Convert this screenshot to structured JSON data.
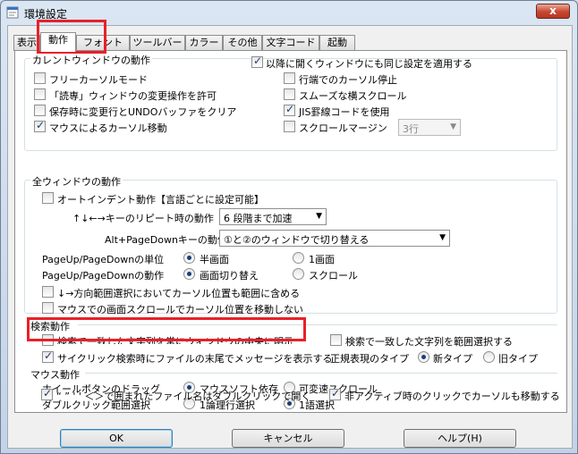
{
  "window": {
    "title": "環境設定",
    "close": "x"
  },
  "tabs": [
    "表示",
    "動作",
    "フォント",
    "ツールバー",
    "カラー",
    "その他",
    "文字コード",
    "起動"
  ],
  "current_window": {
    "title": "カレントウィンドウの動作",
    "apply_future": "以降に開くウィンドウにも同じ設定を適用する",
    "left": [
      {
        "label": "フリーカーソルモード",
        "checked": false
      },
      {
        "label": "「読専」ウィンドウの変更操作を許可",
        "checked": false
      },
      {
        "label": "保存時に変更行とUNDOバッファをクリア",
        "checked": false
      },
      {
        "label": "マウスによるカーソル移動",
        "checked": true
      }
    ],
    "right": [
      {
        "label": "行端でのカーソル停止",
        "checked": false
      },
      {
        "label": "スムーズな横スクロール",
        "checked": false
      },
      {
        "label": "JIS罫線コードを使用",
        "checked": true
      },
      {
        "label": "スクロールマージン",
        "checked": false
      }
    ],
    "margin_value": "3行"
  },
  "all_windows": {
    "title": "全ウィンドウの動作",
    "autoindent": "オートインデント動作【言語ごとに設定可能】",
    "repeat_label": "↑↓←→キーのリピート時の動作",
    "repeat_value": "6 段階まで加速",
    "altpd_label": "Alt+PageDownキーの動作",
    "altpd_value": "①と②のウィンドウで切り替える",
    "pageunit_label": "PageUp/PageDownの単位",
    "pageunit_opt1": "半画面",
    "pageunit_opt2": "1画面",
    "pageact_label": "PageUp/PageDownの動作",
    "pageact_opt1": "画面切り替え",
    "pageact_opt2": "スクロール",
    "range_select": "↓→方向範囲選択においてカーソル位置も範囲に含める",
    "mouse_scroll": "マウスでの画面スクロールでカーソル位置を移動しない"
  },
  "search": {
    "title": "検索動作",
    "center": "検索で一致した文字列を常にウィンドウの中央に明示する",
    "select_match": "検索で一致した文字列を範囲選択する",
    "cyclic": "サイクリック検索時にファイルの末尾でメッセージを表示する",
    "regex_label": "正規表現のタイプ",
    "regex_new": "新タイプ",
    "regex_old": "旧タイプ"
  },
  "mouse": {
    "title": "マウス動作",
    "wheel_label": "ホイールボタンのドラッグ",
    "wheel_opt1": "マウスソフト依存",
    "wheel_opt2": "可変速スクロール",
    "dbl_label": "ダブルクリック範囲選択",
    "dbl_opt1": "1論理行選択",
    "dbl_opt2": "1語選択",
    "quoted_open": "“ ” ' ' ＜＞で囲まれたファイル名はダブルクリックで開く",
    "inactive_click": "非アクティブ時のクリックでカーソルも移動する"
  },
  "buttons": {
    "ok": "OK",
    "cancel": "キャンセル",
    "help": "ヘルプ(H)"
  },
  "colors": {
    "highlight": "#e8202a",
    "accent": "#1d3e7a"
  }
}
